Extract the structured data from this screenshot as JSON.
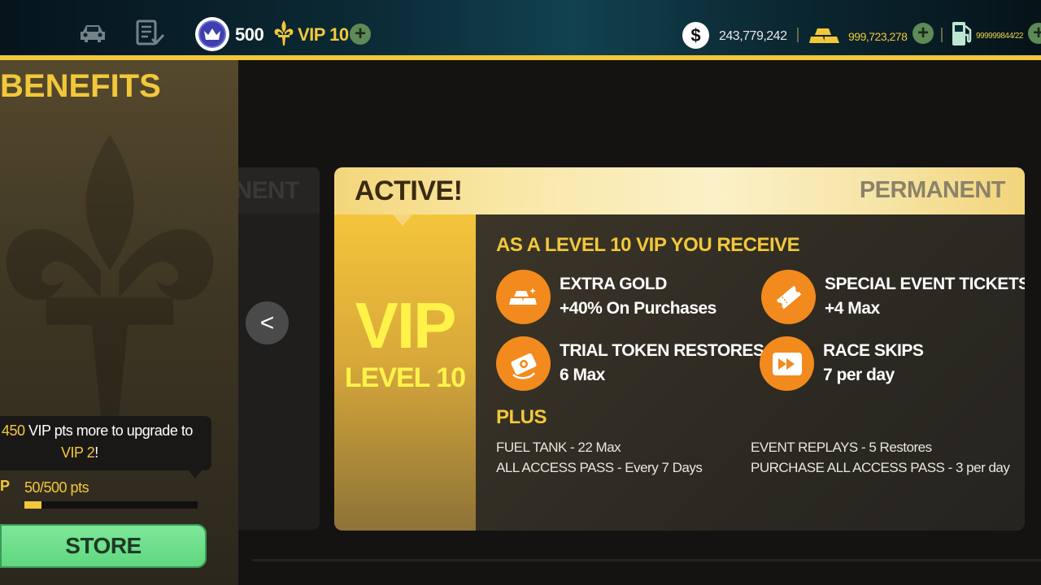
{
  "topbar": {
    "crown_count": "500",
    "vip_label": "VIP 10",
    "cash_symbol": "$",
    "cash_amount": "243,779,242",
    "gold_amount": "999,723,278",
    "fuel_amount": "999999844/22",
    "plus_symbol": "+",
    "icons": [
      "car-icon",
      "checklist-icon",
      "crown-icon",
      "fleur-de-lis-icon",
      "dollar-icon",
      "gold-bars-icon",
      "fuel-pump-icon"
    ]
  },
  "sidebar": {
    "title": "BENEFITS",
    "tooltip_points": "450",
    "tooltip_text": " VIP pts more to upgrade to",
    "tooltip_target": "VIP 2",
    "tooltip_end": "!",
    "progress_prefix": "P",
    "progress_text": "50/500 pts",
    "progress_fraction": 0.1,
    "store_label": "STORE"
  },
  "carousel": {
    "prev_card_label": "PERMANENT",
    "prev_button": "<"
  },
  "card": {
    "status": "ACTIVE!",
    "duration": "PERMANENT",
    "vip_big": "VIP",
    "vip_level": "LEVEL 10",
    "receive_title": "AS A LEVEL 10 VIP YOU RECEIVE",
    "benefits": [
      {
        "title": "EXTRA GOLD",
        "value": "+40% On Purchases",
        "icon": "gold-bars-icon"
      },
      {
        "title": "SPECIAL EVENT TICKETS",
        "value": "+4 Max",
        "icon": "ticket-icon"
      },
      {
        "title": "TRIAL TOKEN RESTORES",
        "value": "6 Max",
        "icon": "token-icon"
      },
      {
        "title": "RACE SKIPS",
        "value": "7 per day",
        "icon": "fast-forward-icon"
      }
    ],
    "plus_title": "PLUS",
    "extras": [
      "FUEL TANK - 22 Max",
      "ALL ACCESS PASS  - Every 7 Days",
      "EVENT REPLAYS - 5 Restores",
      "PURCHASE ALL ACCESS PASS - 3 per day"
    ]
  },
  "colors": {
    "accent_gold": "#f2c83a",
    "benefit_orange": "#f28a1e",
    "store_green": "#6ddf89"
  }
}
